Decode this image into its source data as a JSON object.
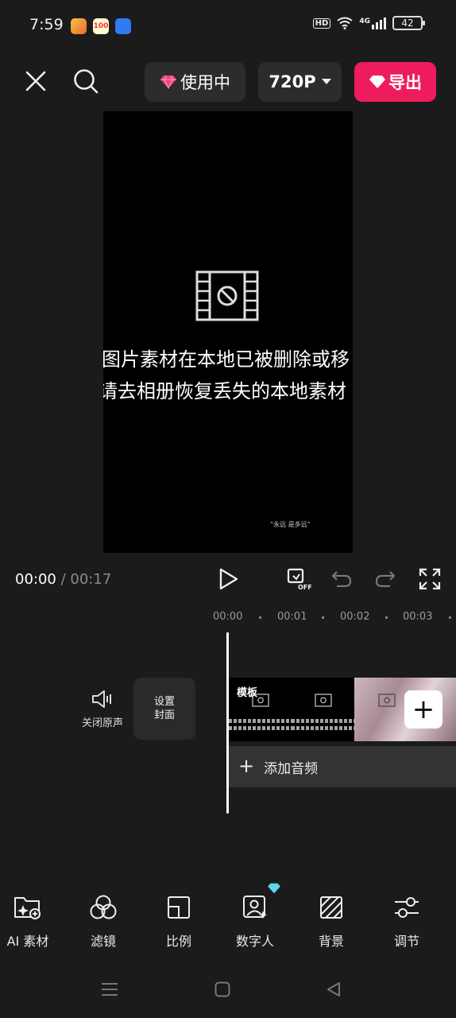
{
  "status": {
    "time": "7:59",
    "hd": "HD",
    "network": "4G",
    "battery": "42"
  },
  "toolbar": {
    "close_icon": "close-icon",
    "search_icon": "search-icon",
    "pro_label": "使用中",
    "resolution": "720P",
    "export_label": "导出",
    "accent": "#ee1c5c"
  },
  "preview": {
    "line1": "图片素材在本地已被删除或移",
    "line2": "请去相册恢复丢失的本地素材",
    "small_text": "“永远 是多远”"
  },
  "playback": {
    "current": "00:00",
    "total": "/ 00:17"
  },
  "timeline": {
    "ticks": [
      "00:00",
      "00:01",
      "00:02",
      "00:03"
    ],
    "mute_label": "关闭原声",
    "cover_line1": "设置",
    "cover_line2": "封面",
    "clip_label": "模板",
    "add_audio": "添加音频"
  },
  "tools": [
    {
      "label": "AI 素材",
      "icon": "folder-ai-icon"
    },
    {
      "label": "滤镜",
      "icon": "filter-icon"
    },
    {
      "label": "比例",
      "icon": "ratio-icon"
    },
    {
      "label": "数字人",
      "icon": "digital-human-icon"
    },
    {
      "label": "背景",
      "icon": "background-icon"
    },
    {
      "label": "调节",
      "icon": "adjust-icon"
    }
  ]
}
